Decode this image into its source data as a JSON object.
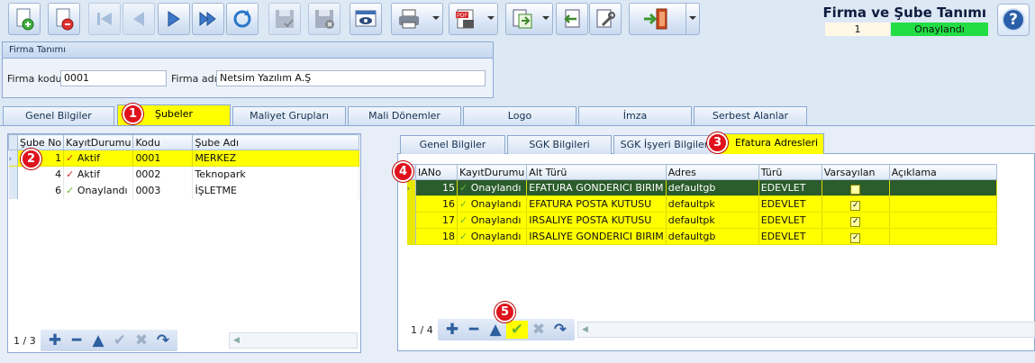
{
  "app": {
    "title": "Firma ve Şube Tanımı",
    "record_id": "1",
    "record_status": "Onaylandı",
    "colors": {
      "status": "#22dd44",
      "highlight": "#ffff00",
      "badge": "#e0121c"
    }
  },
  "toolbar": {
    "buttons": [
      "new-icon",
      "delete-icon",
      "first-icon",
      "prev-icon",
      "next-icon",
      "last-icon",
      "refresh-icon",
      "save-icon",
      "cancel-save-icon",
      "preview-icon",
      "print-icon",
      "pdf-icon",
      "export-icon",
      "import-icon",
      "tools-icon",
      "exit-icon"
    ]
  },
  "firma": {
    "group_title": "Firma Tanımı",
    "kod_label": "Firma kodu",
    "kod_value": "0001",
    "ad_label": "Firma adı",
    "ad_value": "Netsim Yazılım A.Ş"
  },
  "main_tabs": [
    "Genel Bilgiler",
    "Şubeler",
    "Maliyet Grupları",
    "Mali Dönemler",
    "Logo",
    "İmza",
    "Serbest Alanlar"
  ],
  "sub_tabs": [
    "Genel Bilgiler",
    "SGK Bilgileri",
    "SGK İşyeri Bilgileri",
    "Efatura Adresleri"
  ],
  "badges": [
    "1",
    "2",
    "3",
    "4",
    "5"
  ],
  "sube_grid": {
    "columns": [
      "Şube No",
      "KayıtDurumu",
      "Kodu",
      "Şube Adı"
    ],
    "rows": [
      {
        "no": "1",
        "durum": "Aktif",
        "kodu": "0001",
        "ad": "MERKEZ"
      },
      {
        "no": "4",
        "durum": "Aktif",
        "kodu": "0002",
        "ad": "Teknopark"
      },
      {
        "no": "6",
        "durum": "Onaylandı",
        "kodu": "0003",
        "ad": "İŞLETME"
      }
    ],
    "nav_count": "1 / 3"
  },
  "efatura_grid": {
    "columns": [
      "IANo",
      "KayıtDurumu",
      "Alt Türü",
      "Adres",
      "Türü",
      "Varsayılan",
      "Açıklama"
    ],
    "rows": [
      {
        "no": "15",
        "durum": "Onaylandı",
        "alt": "EFATURA GONDERICI BIRIM",
        "adres": "defaultgb",
        "tur": "EDEVLET",
        "vars": "✓",
        "acik": ""
      },
      {
        "no": "16",
        "durum": "Onaylandı",
        "alt": "EFATURA POSTA KUTUSU",
        "adres": "defaultpk",
        "tur": "EDEVLET",
        "vars": "✓",
        "acik": ""
      },
      {
        "no": "17",
        "durum": "Onaylandı",
        "alt": "IRSALIYE POSTA KUTUSU",
        "adres": "defaultpk",
        "tur": "EDEVLET",
        "vars": "✓",
        "acik": ""
      },
      {
        "no": "18",
        "durum": "Onaylandı",
        "alt": "IRSALIYE GONDERICI BIRIM",
        "adres": "defaultgb",
        "tur": "EDEVLET",
        "vars": "✓",
        "acik": ""
      }
    ],
    "nav_count": "1 / 4"
  }
}
